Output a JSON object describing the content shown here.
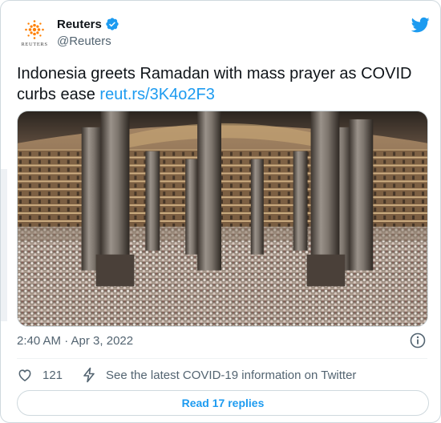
{
  "account": {
    "name": "Reuters",
    "handle": "@Reuters",
    "avatar_text": "REUTERS",
    "verified": true,
    "brand_color": "#ff8000"
  },
  "tweet": {
    "text": "Indonesia greets Ramadan with mass prayer as COVID curbs ease",
    "link": "reut.rs/3K4o2F3",
    "timestamp": "2:40 AM · Apr 3, 2022"
  },
  "actions": {
    "like_count": "121",
    "covid_info": "See the latest COVID-19 information on Twitter"
  },
  "replies_button": "Read 17 replies",
  "icons": [
    "reuters-logo-icon",
    "verified-badge-icon",
    "twitter-bird-icon",
    "info-icon",
    "heart-icon",
    "lightning-icon"
  ],
  "colors": {
    "accent": "#1d9bf0",
    "secondary_text": "#536471",
    "border": "#cfd9de"
  }
}
